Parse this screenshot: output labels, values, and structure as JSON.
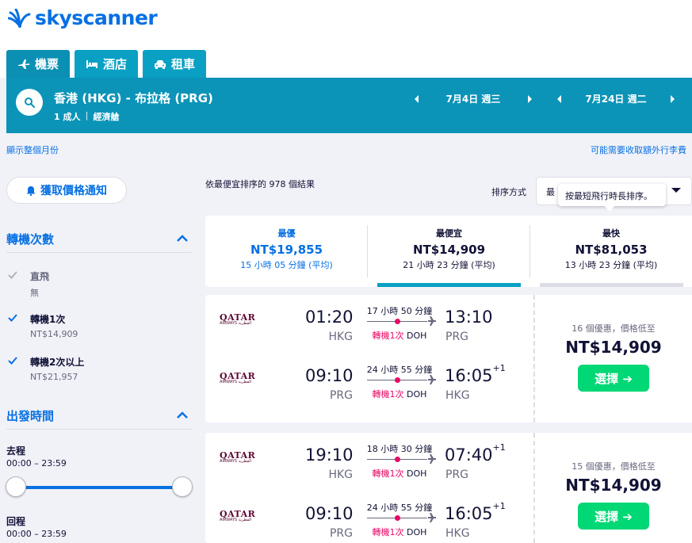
{
  "brand": {
    "name": "skyscanner",
    "color": "#0770e3"
  },
  "tabs": [
    {
      "label": "機票",
      "icon": "plane-icon"
    },
    {
      "label": "酒店",
      "icon": "bed-icon"
    },
    {
      "label": "租車",
      "icon": "car-icon"
    }
  ],
  "search": {
    "route": "香港 (HKG) - 布拉格 (PRG)",
    "passengers": "1 成人",
    "cabin": "經濟艙",
    "depart_date": "7月4日 週三",
    "return_date": "7月24日 週二"
  },
  "links": {
    "month_view": "顯示整個月份",
    "baggage_fee": "可能需要收取額外行李費"
  },
  "sidebar": {
    "alert_button": "獲取價格通知",
    "stops": {
      "title": "轉機次數",
      "options": [
        {
          "label": "直飛",
          "price": "無",
          "checked": true,
          "disabled": true
        },
        {
          "label": "轉機1次",
          "price": "NT$14,909",
          "checked": true,
          "disabled": false
        },
        {
          "label": "轉機2次以上",
          "price": "NT$21,957",
          "checked": true,
          "disabled": false
        }
      ]
    },
    "times": {
      "title": "出發時間",
      "outbound_label": "去程",
      "outbound_range": "00:00 – 23:59",
      "return_label": "回程",
      "return_range": "00:00 – 23:59"
    }
  },
  "results": {
    "count_text": "依最便宜排序的 978 個結果",
    "sort_label": "排序方式",
    "sort_value": "最",
    "tooltip": "按最短飛行時長排序。"
  },
  "sort_tabs": [
    {
      "title": "最優",
      "price": "NT$19,855",
      "duration": "15 小時 05 分鐘 (平均)",
      "color": "#0770e3"
    },
    {
      "title": "最便宜",
      "price": "NT$14,909",
      "duration": "21 小時 23 分鐘 (平均)",
      "color": "#111236"
    },
    {
      "title": "最快",
      "price": "NT$81,053",
      "duration": "13 小時 23 分鐘 (平均)",
      "color": "#111236"
    }
  ],
  "cards": [
    {
      "legs": [
        {
          "airline": "QATAR",
          "airline_sub": "AIRWAYS القطرية",
          "dep_time": "01:20",
          "dep_code": "HKG",
          "duration": "17 小時 50 分鐘",
          "stops": "轉機1次",
          "via": "DOH",
          "arr_time": "13:10",
          "arr_plus": "",
          "arr_code": "PRG"
        },
        {
          "airline": "QATAR",
          "airline_sub": "AIRWAYS القطرية",
          "dep_time": "09:10",
          "dep_code": "PRG",
          "duration": "24 小時 55 分鐘",
          "stops": "轉機1次",
          "via": "DOH",
          "arr_time": "16:05",
          "arr_plus": "+1",
          "arr_code": "HKG"
        }
      ],
      "deals": "16 個優惠，價格低至",
      "price": "NT$14,909",
      "select": "選擇 ➔"
    },
    {
      "legs": [
        {
          "airline": "QATAR",
          "airline_sub": "AIRWAYS القطرية",
          "dep_time": "19:10",
          "dep_code": "HKG",
          "duration": "18 小時 30 分鐘",
          "stops": "轉機1次",
          "via": "DOH",
          "arr_time": "07:40",
          "arr_plus": "+1",
          "arr_code": "PRG"
        },
        {
          "airline": "QATAR",
          "airline_sub": "AIRWAYS القطرية",
          "dep_time": "09:10",
          "dep_code": "PRG",
          "duration": "24 小時 55 分鐘",
          "stops": "轉機1次",
          "via": "DOH",
          "arr_time": "16:05",
          "arr_plus": "+1",
          "arr_code": "HKG"
        }
      ],
      "deals": "15 個優惠，價格低至",
      "price": "NT$14,909",
      "select": "選擇 ➔"
    }
  ]
}
